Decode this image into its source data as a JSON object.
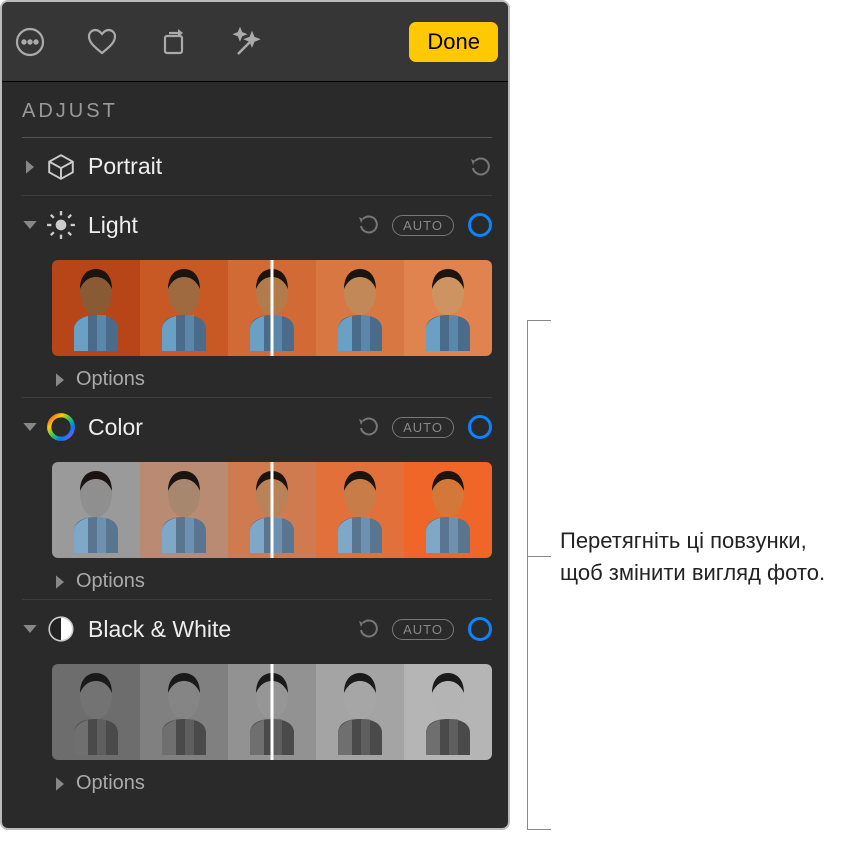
{
  "toolbar": {
    "done_label": "Done"
  },
  "panel": {
    "title": "ADJUST",
    "sections": {
      "portrait": {
        "label": "Portrait"
      },
      "light": {
        "label": "Light",
        "auto": "AUTO",
        "options": "Options"
      },
      "color": {
        "label": "Color",
        "auto": "AUTO",
        "options": "Options"
      },
      "bw": {
        "label": "Black & White",
        "auto": "AUTO",
        "options": "Options"
      }
    }
  },
  "callout": {
    "text": "Перетягніть ці повзунки, щоб змінити вигляд фото."
  },
  "thumbs": {
    "light": {
      "bg": [
        "#b84518",
        "#c85925",
        "#d26a35",
        "#d97742",
        "#e0834f"
      ],
      "skin": [
        "#8a5a35",
        "#a06a40",
        "#b37a4c",
        "#c28857",
        "#cd9462"
      ]
    },
    "color": {
      "bg": [
        "#9a9a9a",
        "#b88b72",
        "#d07a50",
        "#e2703a",
        "#ef6628"
      ],
      "skin": [
        "#8f8f8f",
        "#a8876f",
        "#b98259",
        "#c87d48",
        "#d4783a"
      ]
    },
    "bw": {
      "bg": [
        "#6d6d6d",
        "#808080",
        "#929292",
        "#a4a4a4",
        "#b5b5b5"
      ],
      "skin": [
        "#737373",
        "#858585",
        "#969696",
        "#a6a6a6",
        "#b4b4b4"
      ]
    }
  }
}
